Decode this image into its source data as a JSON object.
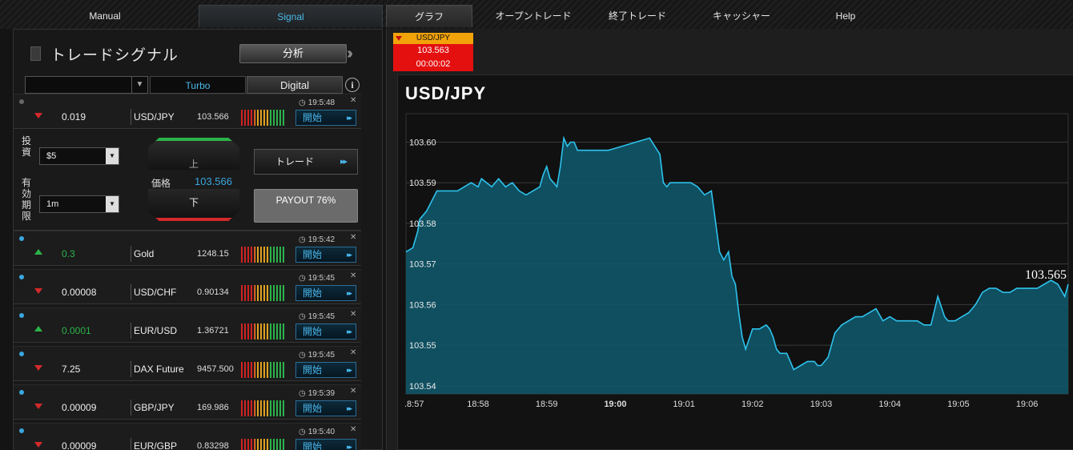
{
  "nav": {
    "manual": "Manual",
    "signal": "Signal",
    "graph": "グラフ",
    "open_trades": "オープントレード",
    "closed_trades": "終了トレード",
    "cashier": "キャッシャー",
    "help": "Help"
  },
  "panel": {
    "title": "トレードシグナル",
    "analyze_label": "分析",
    "filter_value": "",
    "tab_turbo": "Turbo",
    "tab_digital": "Digital",
    "info_icon": "i"
  },
  "signals": [
    {
      "time": "19:5:48",
      "direction": "down",
      "change": "0.019",
      "symbol": "USD/JPY",
      "price": "103.566",
      "open_label": "開始",
      "dot": "gray"
    },
    {
      "time": "19:5:42",
      "direction": "up",
      "change": "0.3",
      "symbol": "Gold",
      "price": "1248.15",
      "open_label": "開始",
      "dot": "blue"
    },
    {
      "time": "19:5:45",
      "direction": "down",
      "change": "0.00008",
      "symbol": "USD/CHF",
      "price": "0.90134",
      "open_label": "開始",
      "dot": "blue"
    },
    {
      "time": "19:5:45",
      "direction": "up",
      "change": "0.0001",
      "symbol": "EUR/USD",
      "price": "1.36721",
      "open_label": "開始",
      "dot": "blue"
    },
    {
      "time": "19:5:45",
      "direction": "down",
      "change": "7.25",
      "symbol": "DAX Future",
      "price": "9457.500",
      "open_label": "開始",
      "dot": "blue"
    },
    {
      "time": "19:5:39",
      "direction": "down",
      "change": "0.00009",
      "symbol": "GBP/JPY",
      "price": "169.986",
      "open_label": "開始",
      "dot": "blue"
    },
    {
      "time": "19:5:40",
      "direction": "down",
      "change": "0.00009",
      "symbol": "EUR/GBP",
      "price": "0.83298",
      "open_label": "開始",
      "dot": "blue"
    }
  ],
  "trade": {
    "invest_label": "投資",
    "invest_value": "$5",
    "expiry_label": "有効期限",
    "expiry_value": "1m",
    "up_label": "上",
    "down_label": "下",
    "price_label": "価格",
    "price_value": "103.566",
    "trade_button": "トレード",
    "payout": "PAYOUT 76%"
  },
  "ticker": {
    "symbol": "USD/JPY",
    "price": "103.563",
    "timer": "00:00:02"
  },
  "colors": {
    "accent_blue": "#3aa7e0",
    "up_green": "#2bb34a",
    "down_red": "#d42a2a",
    "ticker_red": "#e41010",
    "ticker_orange": "#f2a30a",
    "area_fill": "#0f5a6e",
    "line": "#2ec2ec"
  },
  "chart_data": {
    "type": "area",
    "title": "USD/JPY",
    "current_value_label": "103.565",
    "ylim": [
      103.538,
      103.607
    ],
    "y_ticks": [
      "103.54",
      "103.55",
      "103.56",
      "103.57",
      "103.58",
      "103.59",
      "103.60"
    ],
    "x_ticks": [
      ".8:57",
      "18:58",
      "18:59",
      "19:00",
      "19:01",
      "19:02",
      "19:03",
      "19:04",
      "19:05",
      "19:06"
    ],
    "x_tick_bold": "19:00",
    "xlim_minutes": [
      -3.05,
      6.6
    ],
    "grid": true,
    "series": [
      {
        "x": [
          -3.05,
          -2.95,
          -2.88,
          -2.85,
          -2.75,
          -2.6,
          -2.45,
          -2.3,
          -2.2,
          -2.1,
          -2.0,
          -1.95,
          -1.8,
          -1.7,
          -1.6,
          -1.5,
          -1.4,
          -1.3,
          -1.2,
          -1.1,
          -1.05,
          -1.0,
          -0.95,
          -0.9,
          -0.85,
          -0.8,
          -0.75,
          -0.7,
          -0.65,
          -0.6,
          -0.55,
          -0.5,
          -0.4,
          -0.3,
          -0.2,
          -0.1,
          0.1,
          0.3,
          0.5,
          0.65,
          0.7,
          0.75,
          0.8,
          0.9,
          1.0,
          1.1,
          1.2,
          1.3,
          1.4,
          1.52,
          1.58,
          1.65,
          1.7,
          1.75,
          1.8,
          1.85,
          1.9,
          2.0,
          2.1,
          2.2,
          2.25,
          2.3,
          2.35,
          2.4,
          2.5,
          2.6,
          2.7,
          2.8,
          2.9,
          2.95,
          3.0,
          3.1,
          3.2,
          3.3,
          3.4,
          3.5,
          3.6,
          3.7,
          3.8,
          3.9,
          4.0,
          4.1,
          4.2,
          4.3,
          4.4,
          4.5,
          4.6,
          4.7,
          4.8,
          4.85,
          4.95,
          5.05,
          5.15,
          5.25,
          5.35,
          5.45,
          5.55,
          5.65,
          5.75,
          5.85,
          5.95,
          6.05,
          6.15,
          6.25,
          6.35,
          6.45,
          6.55,
          6.6
        ],
        "y": [
          103.573,
          103.574,
          103.578,
          103.581,
          103.583,
          103.588,
          103.588,
          103.588,
          103.589,
          103.59,
          103.589,
          103.591,
          103.589,
          103.591,
          103.589,
          103.59,
          103.588,
          103.587,
          103.588,
          103.589,
          103.592,
          103.594,
          103.591,
          103.59,
          103.589,
          103.594,
          103.601,
          103.599,
          103.6,
          103.6,
          103.598,
          103.598,
          103.598,
          103.598,
          103.598,
          103.598,
          103.599,
          103.6,
          103.601,
          103.597,
          103.59,
          103.589,
          103.59,
          103.59,
          103.59,
          103.59,
          103.589,
          103.587,
          103.588,
          103.573,
          103.571,
          103.573,
          103.567,
          103.565,
          103.558,
          103.552,
          103.549,
          103.554,
          103.554,
          103.555,
          103.554,
          103.552,
          103.549,
          103.548,
          103.548,
          103.544,
          103.545,
          103.546,
          103.546,
          103.545,
          103.545,
          103.547,
          103.553,
          103.555,
          103.556,
          103.557,
          103.557,
          103.558,
          103.559,
          103.556,
          103.557,
          103.556,
          103.556,
          103.556,
          103.556,
          103.555,
          103.555,
          103.562,
          103.557,
          103.556,
          103.556,
          103.557,
          103.558,
          103.56,
          103.563,
          103.564,
          103.564,
          103.563,
          103.563,
          103.564,
          103.564,
          103.564,
          103.564,
          103.565,
          103.566,
          103.565,
          103.562,
          103.565
        ]
      }
    ]
  }
}
